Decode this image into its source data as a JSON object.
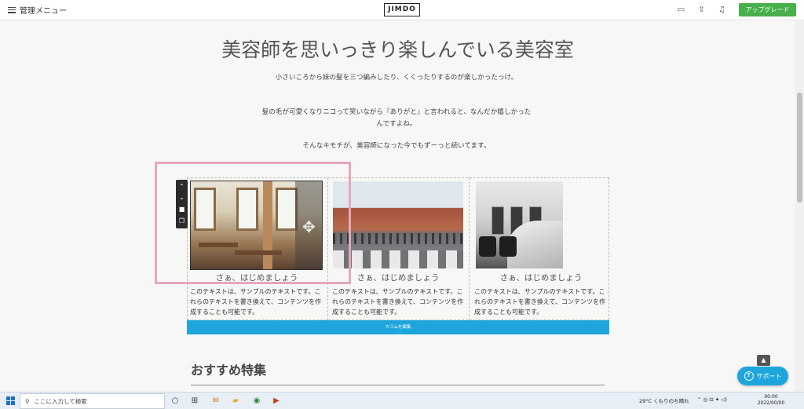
{
  "topbar": {
    "menu_label": "管理メニュー",
    "logo": "JIMDO",
    "upgrade_label": "アップグレード",
    "icons": [
      "monitor-icon",
      "share-icon",
      "bell-icon"
    ]
  },
  "page": {
    "heading": "美容師を思いっきり楽しんでいる美容室",
    "paragraphs": [
      "小さいころから妹の髪を三つ編みしたり、くくったりするのが楽しかったっけ。",
      "髪の毛が可愛くなりニコって笑いながら『ありがと』と言われると、なんだか嬉しかったんですよね。",
      "そんなキモチが、美容師になった今でもずーっと続いてます。"
    ],
    "columns": [
      {
        "title": "さぁ、はじめましょう",
        "text": "このテキストは、サンプルのテキストです。これらのテキストを書き換えて、コンテンツを作成することも可能です。",
        "image": "cafe-interior"
      },
      {
        "title": "さぁ、はじめましょう",
        "text": "このテキストは、サンプルのテキストです。これらのテキストを書き換えて、コンテンツを作成することも可能です。",
        "image": "station-crossing"
      },
      {
        "title": "さぁ、はじめましょう",
        "text": "このテキストは、サンプルのテキストです。これらのテキストを書き換えて、コンテンツを作成することも可能です。",
        "image": "salon-interior"
      }
    ],
    "edit_columns_label": "カラムを編集",
    "section_title": "おすすめ特集"
  },
  "support_label": "サポート",
  "taskbar": {
    "search_placeholder": "ここに入力して検索",
    "weather": "29°C くもりのち晴れ",
    "time": "00:00",
    "date": "2022/00/00"
  },
  "colors": {
    "accent_blue": "#1ea6dc",
    "upgrade_green": "#47b04b",
    "highlight_pink": "#e7a6bd"
  }
}
